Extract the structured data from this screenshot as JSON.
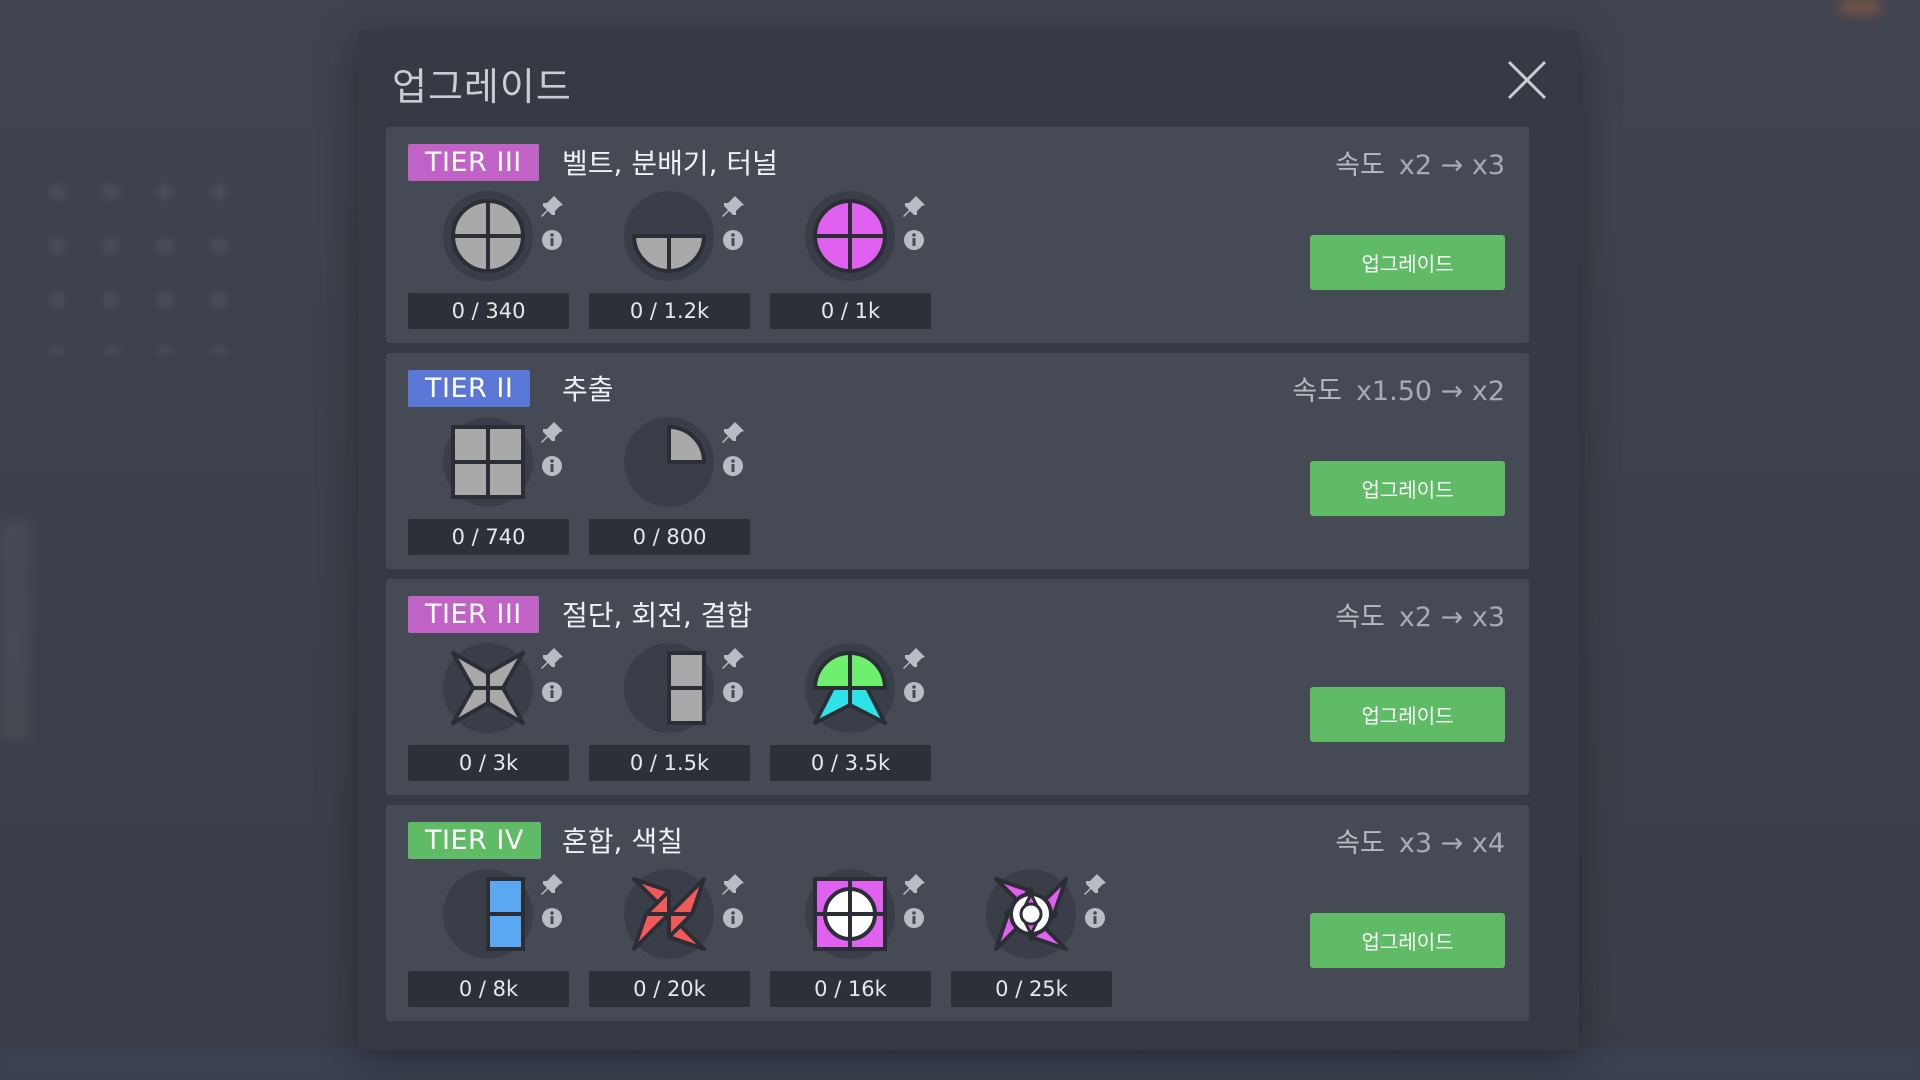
{
  "modal": {
    "title": "업그레이드"
  },
  "colors": {
    "tier2": "#5b77d6",
    "tier3": "#c162c6",
    "tier4": "#5fbb66",
    "button": "#5fbb66"
  },
  "panels": [
    {
      "tier": "TIER III",
      "name": "벨트, 분배기, 터널",
      "speed_label": "속도",
      "speed_value": "x2 → x3",
      "button": "업그레이드",
      "items": [
        {
          "shape": "circle-quarters-gray",
          "count": "0 / 340"
        },
        {
          "shape": "half-circle-gray",
          "count": "0 / 1.2k"
        },
        {
          "shape": "circle-quarters-purple",
          "count": "0 / 1k"
        }
      ]
    },
    {
      "tier": "TIER II",
      "name": "추출",
      "speed_label": "속도",
      "speed_value": "x1.50 → x2",
      "button": "업그레이드",
      "items": [
        {
          "shape": "square-quarters-gray",
          "count": "0 / 740"
        },
        {
          "shape": "quarter-circle-gray",
          "count": "0 / 800"
        }
      ]
    },
    {
      "tier": "TIER III",
      "name": "절단, 회전, 결합",
      "speed_label": "속도",
      "speed_value": "x2 → x3",
      "button": "업그레이드",
      "items": [
        {
          "shape": "star-gray",
          "count": "0 / 3k"
        },
        {
          "shape": "half-rect-gray",
          "count": "0 / 1.5k"
        },
        {
          "shape": "mixed-green-cyan",
          "count": "0 / 3.5k"
        }
      ]
    },
    {
      "tier": "TIER IV",
      "name": "혼합, 색칠",
      "speed_label": "속도",
      "speed_value": "x3 → x4",
      "button": "업그레이드",
      "items": [
        {
          "shape": "half-rect-blue",
          "count": "0 / 8k"
        },
        {
          "shape": "windmill-red",
          "count": "0 / 20k"
        },
        {
          "shape": "square-circle-purple",
          "count": "0 / 16k"
        },
        {
          "shape": "complex-purple",
          "count": "0 / 25k"
        }
      ]
    }
  ]
}
